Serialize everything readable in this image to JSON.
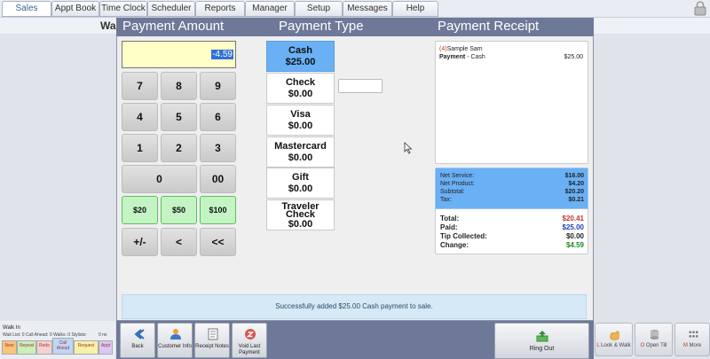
{
  "nav": {
    "tabs": [
      "Sales",
      "Appt Book",
      "Time Clock",
      "Scheduler",
      "Reports",
      "Manager",
      "Setup",
      "Messages",
      "Help"
    ],
    "active_tab": "Sales"
  },
  "background": {
    "header_fragment": "Wa",
    "walk_in_title": "Walk In",
    "walk_stats": "Wait List: 0   Call Ahead: 0   Walks: 0   Stylists:",
    "walk_extra": "0 mi",
    "walk_buttons": [
      "New",
      "Repeat",
      "Redo",
      "Call Ahead",
      "Request",
      "Appt"
    ],
    "right_buttons": [
      {
        "prefix": "L",
        "label": "Look & Walk"
      },
      {
        "prefix": "O",
        "label": "Open Till"
      },
      {
        "prefix": "M",
        "label": "More"
      }
    ]
  },
  "modal": {
    "payment_amount_title": "Payment Amount",
    "payment_type_title": "Payment Type",
    "payment_receipt_title": "Payment Receipt",
    "amount_display": "-4.59",
    "keypad": [
      "7",
      "8",
      "9",
      "4",
      "5",
      "6",
      "1",
      "2",
      "3",
      "0",
      "00",
      "$20",
      "$50",
      "$100",
      "+/-",
      "<",
      "<<"
    ],
    "payment_types": [
      {
        "name": "Cash",
        "amount": "$25.00",
        "active": true
      },
      {
        "name": "Check",
        "amount": "$0.00"
      },
      {
        "name": "Visa",
        "amount": "$0.00"
      },
      {
        "name": "Mastercard",
        "amount": "$0.00"
      },
      {
        "name": "Gift",
        "amount": "$0.00"
      },
      {
        "name": "Traveler Check",
        "amount": "$0.00"
      }
    ],
    "receipt": {
      "customer_count": "(4)",
      "customer_name": "Sample Sam",
      "payment_label": "Payment",
      "payment_method": "- Cash",
      "payment_amount": "$25.00"
    },
    "summary": {
      "net_service_label": "Net Service:",
      "net_service": "$16.00",
      "net_product_label": "Net Product:",
      "net_product": "$4.20",
      "subtotal_label": "Subtotal:",
      "subtotal": "$20.20",
      "tax_label": "Tax:",
      "tax": "$0.21",
      "total_label": "Total:",
      "total": "$20.41",
      "paid_label": "Paid:",
      "paid": "$25.00",
      "tip_label": "Tip Collected:",
      "tip": "$0.00",
      "change_label": "Change:",
      "change": "$4.59"
    },
    "status_message": "Successfully added $25.00 Cash payment to sale."
  },
  "footer": {
    "back": "Back",
    "customer_info": "Customer Info",
    "receipt_notes": "Receipt Notes",
    "void_last_payment": "Void Last Payment",
    "ring_out": "Ring Out"
  },
  "colors": {
    "header": "#6e7898",
    "active_payment": "#69b0f5",
    "amount_display_bg": "#ffffc6",
    "total_red": "#c0392b",
    "paid_blue": "#1f3fbf",
    "change_green": "#1f8a1f"
  }
}
